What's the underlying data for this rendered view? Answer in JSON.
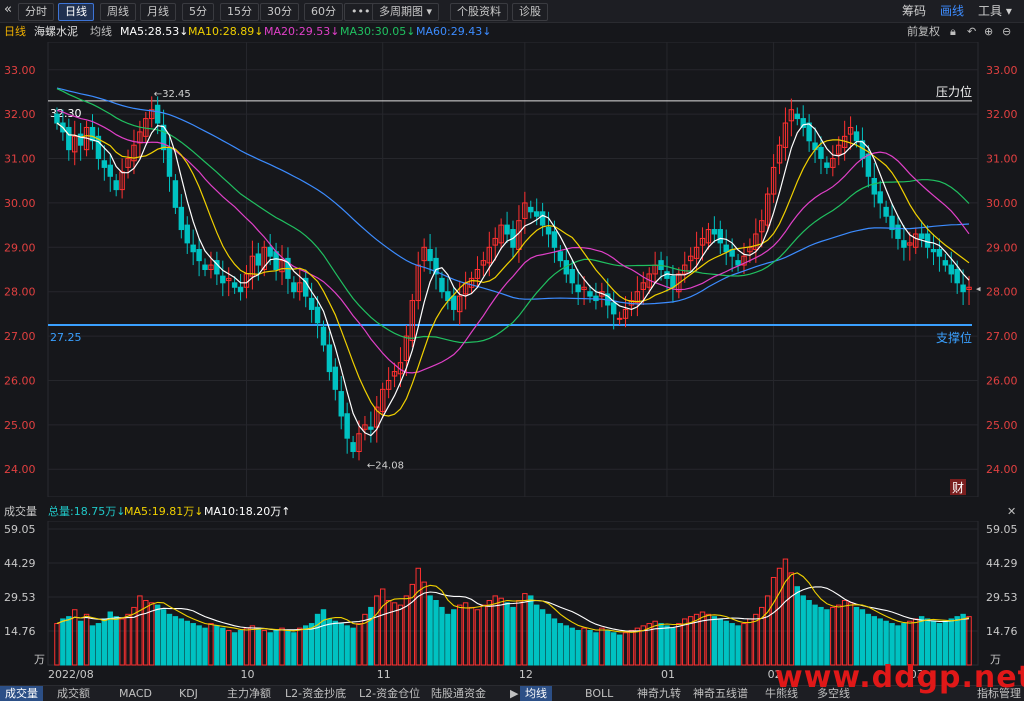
{
  "toolbar": {
    "back_icon": "«",
    "tabs": [
      "分时",
      "日线",
      "周线",
      "月线",
      "5分",
      "15分",
      "30分",
      "60分",
      "•••",
      "多周期图 ▾",
      "个股资料",
      "诊股"
    ],
    "active_tab": "日线",
    "right": [
      "筹码",
      "画线",
      "工具 ▾"
    ]
  },
  "info": {
    "period": "日线",
    "stock": "海螺水泥",
    "indicator": "均线",
    "ma5": "MA5:28.53↓",
    "ma10": "MA10:28.89↓",
    "ma20": "MA20:29.53↓",
    "ma30": "MA30:30.05↓",
    "ma60": "MA60:29.43↓",
    "adjust": "前复权"
  },
  "colors": {
    "up": "#ff3030",
    "down": "#00c2c2",
    "ma5": "#ffffff",
    "ma10": "#f0d000",
    "ma20": "#e040c8",
    "ma30": "#20c060",
    "ma60": "#3c8cff",
    "resistance": "#e0e0e0",
    "support": "#3aa0ff"
  },
  "price_annotations": {
    "resistance_label": "压力位",
    "support_label": "支撑位",
    "resistance_price": "32.30",
    "support_price": "27.25",
    "high": "←32.45",
    "low": "←24.08",
    "cai": "财"
  },
  "volume_info": {
    "title": "成交量",
    "total": "总量:18.75万↓",
    "ma5": "MA5:19.81万↓",
    "ma10": "MA10:18.20万↑"
  },
  "volume_axis": [
    "59.05",
    "44.29",
    "29.53",
    "14.76",
    "万"
  ],
  "bottom_tabs_left": [
    "成交量",
    "成交额",
    "MACD",
    "KDJ",
    "主力净额",
    "L2-资金抄底",
    "L2-资金仓位",
    "陆股通资金"
  ],
  "bottom_tabs_right": [
    "均线",
    "BOLL",
    "神奇九转",
    "神奇五线谱",
    "牛熊线",
    "多空线"
  ],
  "bottom_right": "指标管理",
  "watermark": "www.ddgp.net",
  "chart_data": {
    "type": "candlestick",
    "yticks": [
      "33.00",
      "32.00",
      "31.00",
      "30.00",
      "29.00",
      "28.00",
      "27.00",
      "26.00",
      "25.00",
      "24.00"
    ],
    "ylim": [
      23.6,
      33.4
    ],
    "xlabels": [
      {
        "label": "2022/08",
        "i": 0
      },
      {
        "label": "10",
        "i": 32
      },
      {
        "label": "11",
        "i": 55
      },
      {
        "label": "12",
        "i": 79
      },
      {
        "label": "01",
        "i": 103
      },
      {
        "label": "02",
        "i": 121
      },
      {
        "label": "03",
        "i": 145
      }
    ],
    "resistance": 32.3,
    "support": 27.25,
    "high": {
      "value": 32.45,
      "i": 16
    },
    "low": {
      "value": 24.08,
      "i": 52
    },
    "closes": [
      31.8,
      31.6,
      31.2,
      31.5,
      31.3,
      31.7,
      31.4,
      31.0,
      30.8,
      30.6,
      30.3,
      30.7,
      31.0,
      31.3,
      31.6,
      31.9,
      32.1,
      31.8,
      31.2,
      30.6,
      29.9,
      29.4,
      29.1,
      28.9,
      28.7,
      28.5,
      28.6,
      28.4,
      28.2,
      28.3,
      28.1,
      28.0,
      28.4,
      28.8,
      28.6,
      29.0,
      28.8,
      28.5,
      28.7,
      28.3,
      28.0,
      28.2,
      27.9,
      27.6,
      27.3,
      26.8,
      26.2,
      25.8,
      25.2,
      24.7,
      24.4,
      24.8,
      25.0,
      24.9,
      25.4,
      25.8,
      26.0,
      26.2,
      26.4,
      27.0,
      27.8,
      28.6,
      29.0,
      28.7,
      28.4,
      28.0,
      27.8,
      27.6,
      27.9,
      28.2,
      28.3,
      28.5,
      28.7,
      29.0,
      29.2,
      29.5,
      29.3,
      29.0,
      29.6,
      30.0,
      29.8,
      29.7,
      29.5,
      29.3,
      29.0,
      28.7,
      28.4,
      28.2,
      28.0,
      28.1,
      27.9,
      27.8,
      28.0,
      27.7,
      27.5,
      27.4,
      27.6,
      27.8,
      28.0,
      28.2,
      28.4,
      28.6,
      28.5,
      28.3,
      28.1,
      28.4,
      28.6,
      28.8,
      29.0,
      29.2,
      29.4,
      29.3,
      29.1,
      28.9,
      28.8,
      28.6,
      28.8,
      29.0,
      29.3,
      29.6,
      30.2,
      30.8,
      31.3,
      31.8,
      32.1,
      31.9,
      31.7,
      31.4,
      31.2,
      31.0,
      30.8,
      31.0,
      31.3,
      31.5,
      31.7,
      31.4,
      31.0,
      30.6,
      30.2,
      30.0,
      29.7,
      29.4,
      29.2,
      29.0,
      29.1,
      29.3,
      29.2,
      29.0,
      28.9,
      28.8,
      28.6,
      28.4,
      28.2,
      28.0,
      28.1
    ],
    "volumes": [
      18,
      20,
      21,
      24,
      19,
      22,
      17,
      18,
      20,
      23,
      21,
      20,
      22,
      25,
      30,
      28,
      27,
      26,
      24,
      22,
      21,
      20,
      19,
      18,
      17,
      16,
      18,
      17,
      16,
      15,
      14,
      15,
      16,
      17,
      16,
      15,
      14,
      15,
      16,
      15,
      14,
      16,
      17,
      18,
      22,
      24,
      20,
      19,
      18,
      17,
      16,
      18,
      22,
      25,
      30,
      33,
      28,
      27,
      26,
      30,
      35,
      42,
      36,
      30,
      28,
      25,
      22,
      24,
      26,
      27,
      25,
      24,
      26,
      28,
      30,
      29,
      27,
      25,
      28,
      31,
      30,
      26,
      24,
      22,
      20,
      18,
      17,
      16,
      15,
      16,
      15,
      14,
      16,
      15,
      14,
      13,
      14,
      15,
      16,
      17,
      18,
      19,
      18,
      17,
      16,
      18,
      20,
      21,
      22,
      23,
      22,
      21,
      20,
      19,
      18,
      17,
      18,
      20,
      22,
      25,
      30,
      38,
      42,
      46,
      40,
      34,
      30,
      28,
      26,
      25,
      24,
      25,
      26,
      28,
      27,
      25,
      24,
      22,
      21,
      20,
      19,
      18,
      17,
      18,
      19,
      20,
      21,
      20,
      19,
      18,
      19,
      20,
      21,
      22,
      21
    ]
  }
}
